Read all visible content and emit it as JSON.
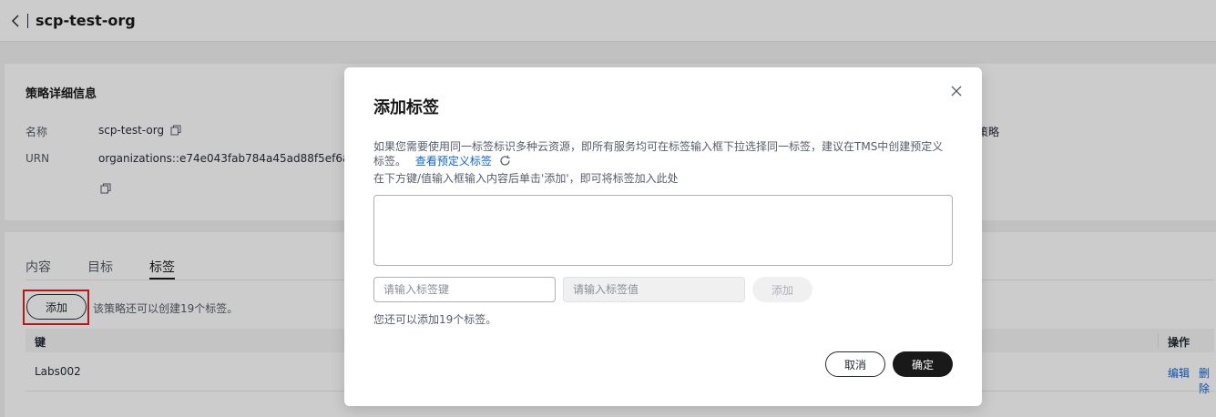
{
  "header": {
    "title": "scp-test-org"
  },
  "detail": {
    "section_title": "策略详细信息",
    "name_label": "名称",
    "name_value": "scp-test-org",
    "urn_label": "URN",
    "urn_value": "organizations::e74e043fab784a45ad88f5ef6a4bcff",
    "right_partial": "策略"
  },
  "tabs": [
    {
      "label": "内容"
    },
    {
      "label": "目标"
    },
    {
      "label": "标签"
    }
  ],
  "tags_panel": {
    "add_label": "添加",
    "hint": "该策略还可以创建19个标签。",
    "columns": {
      "key": "键",
      "actions": "操作"
    },
    "rows": [
      {
        "key": "Labs002",
        "edit": "编辑",
        "delete": "删除"
      }
    ]
  },
  "modal": {
    "title": "添加标签",
    "desc_line1": "如果您需要使用同一标签标识多种云资源，即所有服务均可在标签输入框下拉选择同一标签，建议在TMS中创建预定义",
    "desc_line2_prefix": "标签。",
    "predefined_link": "查看预定义标签",
    "desc_instruction": "在下方键/值输入框输入内容后单击'添加'，即可将标签加入此处",
    "key_placeholder": "请输入标签键",
    "value_placeholder": "请输入标签值",
    "add_label": "添加",
    "remain_hint": "您还可以添加19个标签。",
    "cancel_label": "取消",
    "confirm_label": "确定"
  },
  "colors": {
    "link": "#0d65d9",
    "highlight": "#e02020",
    "primary_button": "#191919"
  }
}
